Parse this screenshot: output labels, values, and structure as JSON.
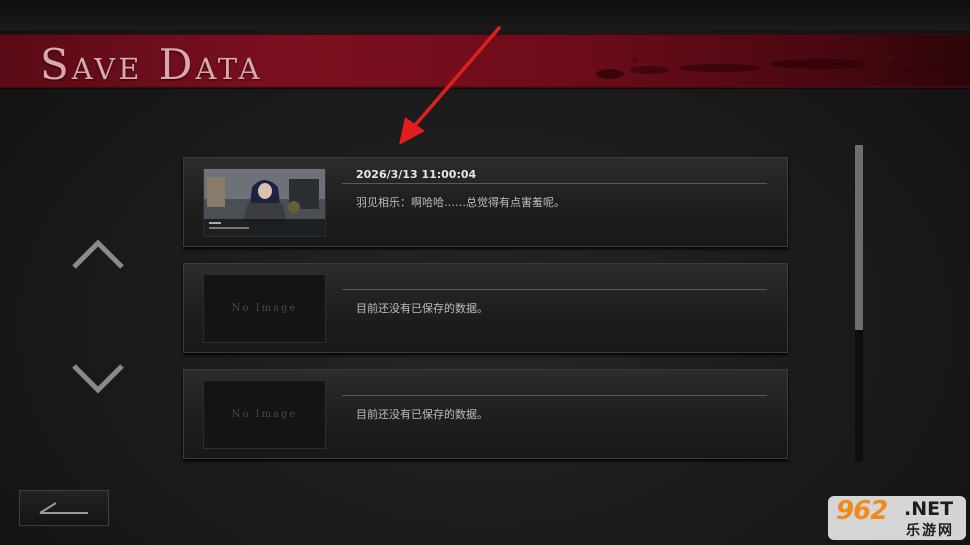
{
  "header": {
    "title": "Save Data"
  },
  "navigation": {
    "up_icon": "chevron-up-icon",
    "down_icon": "chevron-down-icon",
    "back_icon": "back-arrow-icon"
  },
  "slots": [
    {
      "date": "2026/3/13 11:00:04",
      "text": "羽见相乐：啊哈哈……总觉得有点害羞呢。",
      "has_image": true,
      "thumbnail_text": ""
    },
    {
      "date": "",
      "text": "目前还没有已保存的数据。",
      "has_image": false,
      "thumbnail_text": "No Image"
    },
    {
      "date": "",
      "text": "目前还没有已保存的数据。",
      "has_image": false,
      "thumbnail_text": "No Image"
    }
  ],
  "watermark": {
    "number": "962",
    "suffix": ".NET",
    "site": "乐游网"
  },
  "colors": {
    "banner": "#7d1020",
    "title": "#d9a7ac",
    "annotation_arrow": "#e01e1e",
    "watermark_orange": "#f08a1c"
  }
}
